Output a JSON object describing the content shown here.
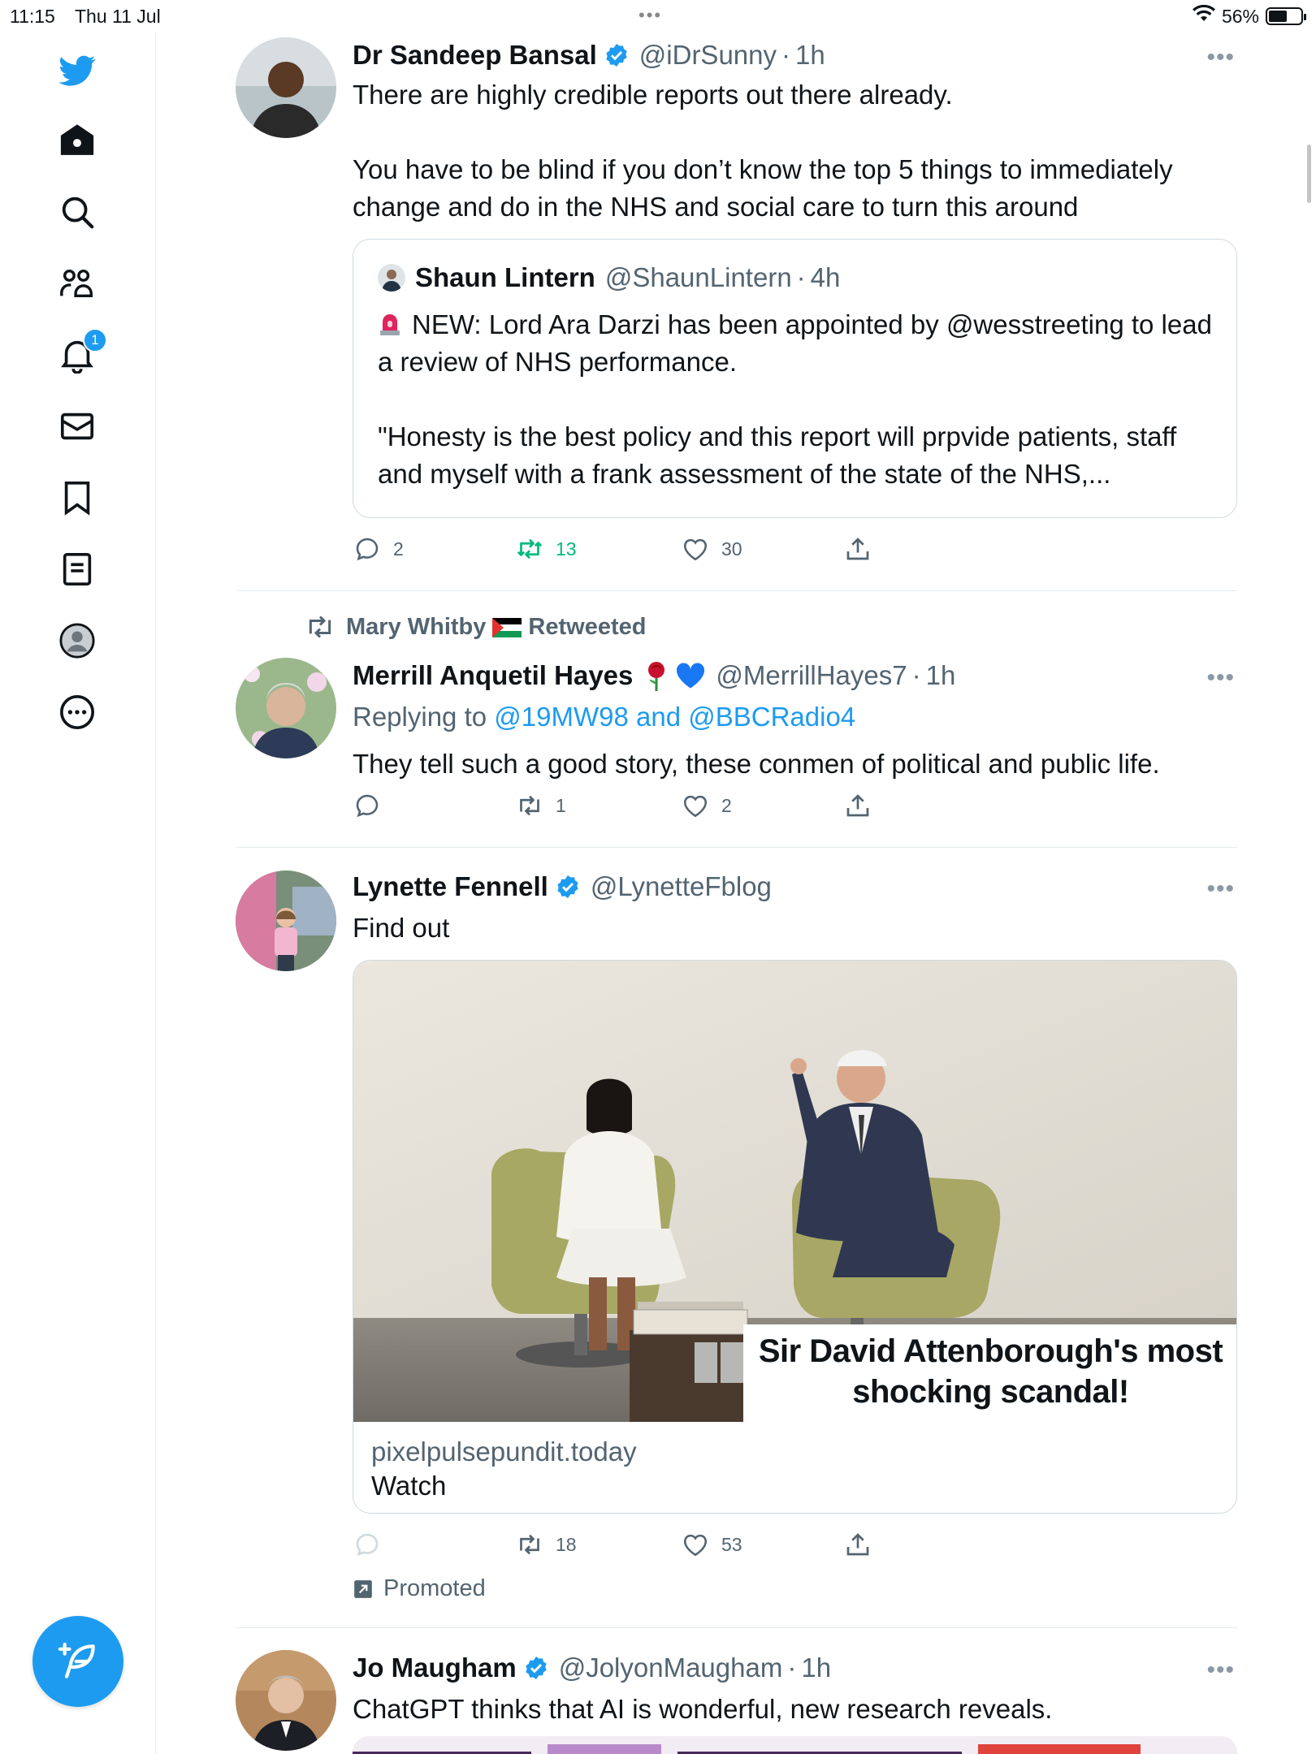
{
  "status_bar": {
    "time": "11:15",
    "date": "Thu 11 Jul",
    "dots": "•••",
    "battery": "56%",
    "battery_level": 0.56
  },
  "sidebar": {
    "notification_count": "1",
    "items": [
      {
        "name": "home",
        "icon": "home-icon"
      },
      {
        "name": "explore",
        "icon": "search-icon"
      },
      {
        "name": "communities",
        "icon": "people-icon"
      },
      {
        "name": "notifications",
        "icon": "bell-icon"
      },
      {
        "name": "messages",
        "icon": "mail-icon"
      },
      {
        "name": "bookmarks",
        "icon": "bookmark-icon"
      },
      {
        "name": "lists",
        "icon": "list-icon"
      },
      {
        "name": "profile",
        "icon": "profile-icon"
      },
      {
        "name": "more",
        "icon": "more-circle-icon"
      }
    ]
  },
  "colors": {
    "accent": "#1d9bf0",
    "retweet_green": "#00ba7c",
    "muted": "#536471"
  },
  "tweets": [
    {
      "name": "Dr Sandeep Bansal",
      "handle": "@iDrSunny",
      "sep": "·",
      "time": "1h",
      "text1": "There are highly credible reports out there already.",
      "text2": "You have to be blind if you don’t know the top 5 things to immediately change and do in the NHS and social care to turn this around",
      "quote": {
        "name": "Shaun Lintern",
        "handle": "@ShaunLintern",
        "sep": "·",
        "time": "4h",
        "text1": "NEW: Lord Ara Darzi has been appointed by @wesstreeting to lead a review of NHS performance.",
        "text2": "\"Honesty is the best policy and this report will prpvide patients, staff and myself with a frank assessment of the state of the NHS,..."
      },
      "replies": "2",
      "retweets": "13",
      "likes": "30"
    },
    {
      "retweeted_by": "Mary Whitby",
      "retweeted_label": "Retweeted",
      "name": "Merrill Anquetil Hayes",
      "handle": "@MerrillHayes7",
      "sep": "·",
      "time": "1h",
      "replying_prefix": "Replying to",
      "replying_to": "@19MW98 and @BBCRadio4",
      "text1": "They tell such a good story, these conmen of political and public life.",
      "replies": "",
      "retweets": "1",
      "likes": "2"
    },
    {
      "name": "Lynette Fennell",
      "handle": "@LynetteFblog",
      "text1": "Find out",
      "card": {
        "overlay": "Sir David Attenborough's most shocking scandal!",
        "domain": "pixelpulsepundit.today",
        "title": "Watch"
      },
      "replies": "",
      "retweets": "18",
      "likes": "53",
      "promoted": "Promoted"
    },
    {
      "name": "Jo Maugham",
      "handle": "@JolyonMaugham",
      "sep": "·",
      "time": "1h",
      "text1": "ChatGPT thinks that AI is wonderful, new research reveals."
    }
  ],
  "more_label": "•••"
}
